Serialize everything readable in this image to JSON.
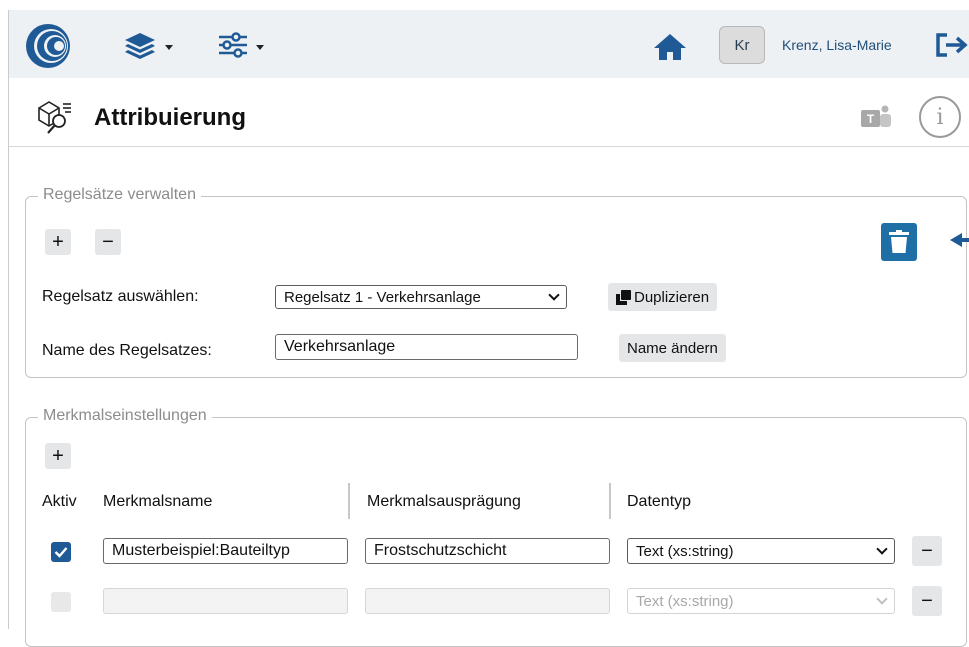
{
  "topbar": {
    "avatar_initials": "Kr",
    "user_name": "Krenz, Lisa-Marie",
    "accent_color": "#1f5a96"
  },
  "header": {
    "title": "Attribuierung"
  },
  "ruleset_panel": {
    "legend": "Regelsätze verwalten",
    "add_label": "+",
    "remove_label": "−",
    "select_label": "Regelsatz auswählen:",
    "select_value": "Regelsatz 1 - Verkehrsanlage",
    "duplicate_label": "Duplizieren",
    "name_label": "Name des Regelsatzes:",
    "name_value": "Verkehrsanlage",
    "rename_label": "Name ändern"
  },
  "features_panel": {
    "legend": "Merkmalseinstellungen",
    "add_label": "+",
    "columns": [
      "Aktiv",
      "Merkmalsname",
      "Merkmalsausprägung",
      "Datentyp"
    ],
    "rows": [
      {
        "active": true,
        "name": "Musterbeispiel:Bauteiltyp",
        "value": "Frostschutzschicht",
        "datatype": "Text (xs:string)",
        "remove_label": "−",
        "disabled": false
      },
      {
        "active": false,
        "name": "",
        "value": "",
        "datatype": "Text (xs:string)",
        "remove_label": "−",
        "disabled": true
      }
    ]
  },
  "icons": {
    "logo": "globe-logo-icon",
    "layers": "layers-icon",
    "settings": "sliders-icon",
    "home": "home-icon",
    "logout": "logout-icon",
    "page": "attribution-icon",
    "teams": "teams-icon",
    "info": "info-icon",
    "trash": "trash-icon",
    "duplicate": "copy-icon"
  }
}
